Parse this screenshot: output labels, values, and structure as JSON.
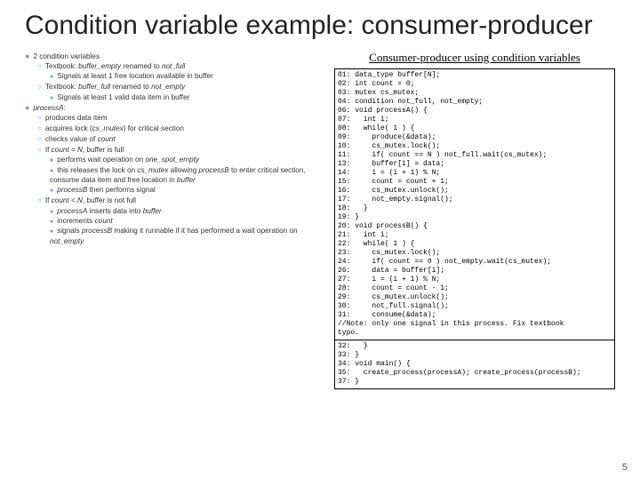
{
  "title": "Condition variable example: consumer-producer",
  "left": {
    "b1": {
      "head": "2 condition variables",
      "i1": {
        "t": "Textbook: buffer_empty renamed to not_full",
        "s1": "Signals at least 1 free location available in buffer"
      },
      "i2": {
        "t": "Textbook: buffer_full renamed to not_empty",
        "s1": "Signals at least 1 valid data item in buffer"
      }
    },
    "b2": {
      "head": "processA:",
      "i1": "produces data item",
      "i2": "acquires lock (cs_mutex) for critical section",
      "i3": "checks value of count",
      "i4": {
        "t": "If count = N, buffer is full",
        "s1": "performs wait operation on one_spot_empty",
        "s2": "this releases the lock on cs_mutex allowing processB to enter critical section, consume data item and free location in buffer",
        "s3": "processB then performs signal"
      },
      "i5": {
        "t": "If count < N, buffer is not full",
        "s1": "processA inserts data into buffer",
        "s2": "increments count",
        "s3": "signals processB making it runnable if it has performed a wait operation on not_empty"
      }
    }
  },
  "right": {
    "title": "Consumer-producer using condition variables",
    "code1": "01: data_type buffer[N];\n02: int count = 0;\n03: mutex cs_mutex;\n04: condition not_full, not_empty;\n06: void processA() {\n07:   int i;\n08:   while( 1 ) {\n09:     produce(&data);\n10:     cs_mutex.lock();\n11:     if( count == N ) not_full.wait(cs_mutex);\n13:     buffer[i] = data;\n14:     i = (i + 1) % N;\n15:     count = count + 1;\n16:     cs_mutex.unlock();\n17:     not_empty.signal();\n18:   }\n19: }\n20: void processB() {\n21:   int i;\n22:   while( 1 ) {\n23:     cs_mutex.lock();\n24:     if( count == 0 ) not_empty.wait(cs_mutex);\n26:     data = buffer[i];\n27:     i = (i + 1) % N;\n28:     count = count - 1;\n29:     cs_mutex.unlock();\n30:     not_full.signal();\n31:     consume(&data);\n//Note: only one signal in this process. Fix textbook\ntypo.",
    "code2": "32:   }\n33: }\n34: void main() {\n35:   create_process(processA); create_process(processB);\n37: }"
  },
  "pagenum": "5"
}
